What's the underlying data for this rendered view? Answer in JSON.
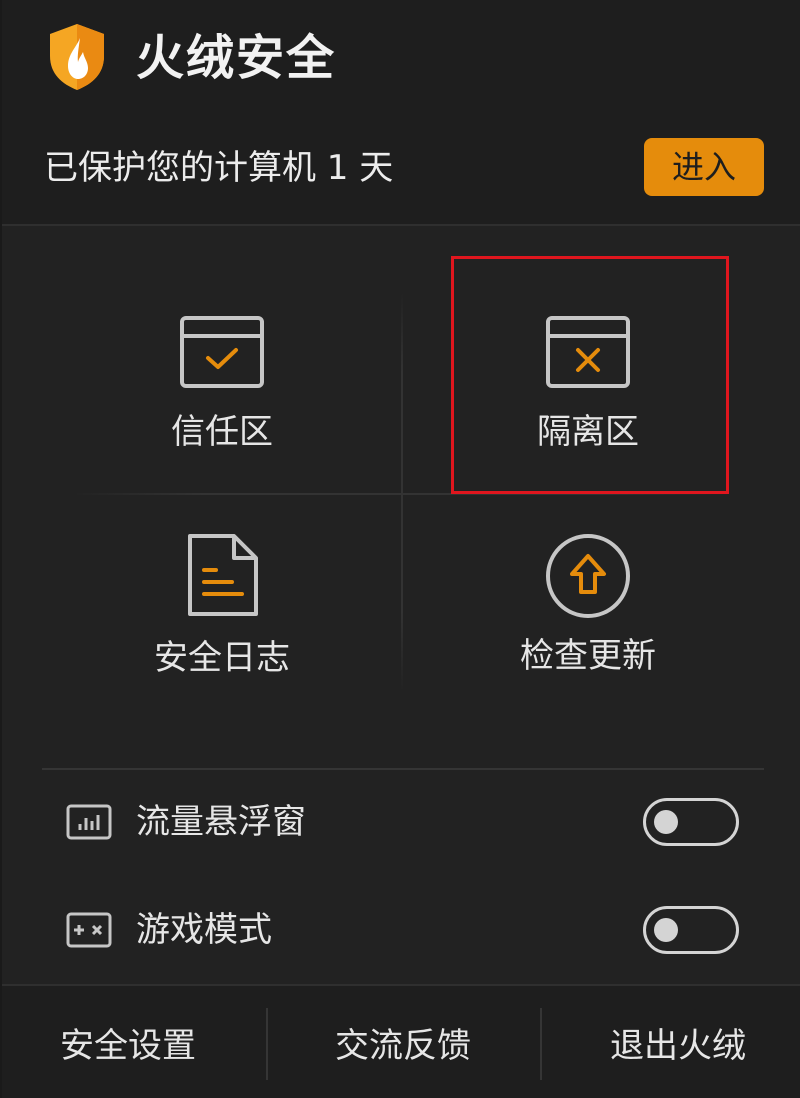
{
  "header": {
    "brand": "火绒安全",
    "protect_text": "已保护您的计算机 1 天",
    "enter_label": "进入"
  },
  "tiles": [
    {
      "label": "信任区",
      "icon": "trust-zone-icon"
    },
    {
      "label": "隔离区",
      "icon": "quarantine-icon"
    },
    {
      "label": "安全日志",
      "icon": "log-document-icon"
    },
    {
      "label": "检查更新",
      "icon": "update-arrow-icon"
    }
  ],
  "settings": [
    {
      "label": "流量悬浮窗",
      "icon": "traffic-chart-icon",
      "enabled": false
    },
    {
      "label": "游戏模式",
      "icon": "gamepad-icon",
      "enabled": false
    }
  ],
  "footer": {
    "items": [
      "安全设置",
      "交流反馈",
      "退出火绒"
    ]
  },
  "colors": {
    "accent": "#e58c0c",
    "highlight": "#e0161e",
    "icon_outline": "#c6c6c6",
    "background": "#222222"
  }
}
